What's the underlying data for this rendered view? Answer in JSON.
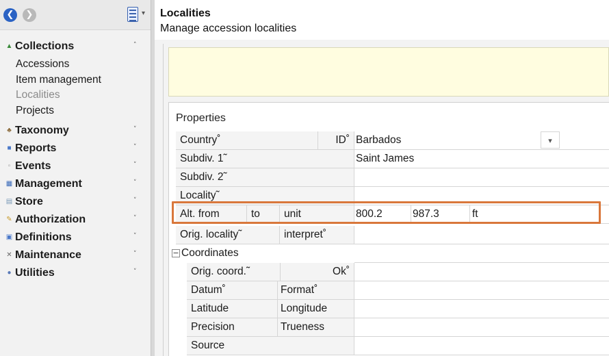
{
  "toolbar": {
    "back_glyph": "❮",
    "forward_glyph": "❯",
    "dropdown_glyph": "▾"
  },
  "sidebar": {
    "sections": [
      {
        "label": "Collections",
        "icon": "collections-icon",
        "icon_color": "#3a8a3a",
        "toggle": "˄",
        "expanded": true,
        "items": [
          "Accessions",
          "Item management",
          "Localities",
          "Projects"
        ],
        "selected": "Localities"
      },
      {
        "label": "Taxonomy",
        "icon": "taxonomy-icon",
        "icon_color": "#8a6a3a",
        "toggle": "˅"
      },
      {
        "label": "Reports",
        "icon": "reports-icon",
        "icon_color": "#4b79c9",
        "toggle": "˅"
      },
      {
        "label": "Events",
        "icon": "events-icon",
        "icon_color": "#9a9a9a",
        "toggle": "˅"
      },
      {
        "label": "Management",
        "icon": "management-icon",
        "icon_color": "#3a6ab9",
        "toggle": "˅"
      },
      {
        "label": "Store",
        "icon": "store-icon",
        "icon_color": "#7a9ab8",
        "toggle": "˅"
      },
      {
        "label": "Authorization",
        "icon": "authorization-icon",
        "icon_color": "#c79a2a",
        "toggle": "˅"
      },
      {
        "label": "Definitions",
        "icon": "definitions-icon",
        "icon_color": "#4b79c9",
        "toggle": "˅"
      },
      {
        "label": "Maintenance",
        "icon": "maintenance-icon",
        "icon_color": "#666666",
        "toggle": "˅"
      },
      {
        "label": "Utilities",
        "icon": "utilities-icon",
        "icon_color": "#5a7ab8",
        "toggle": "˅"
      }
    ]
  },
  "header": {
    "title": "Localities",
    "subtitle": "Manage accession localities"
  },
  "properties": {
    "header": "Properties",
    "country_label": "Country˚",
    "id_label": "ID˚",
    "country_value": "Barbados",
    "subdiv1_label": "Subdiv. 1˜",
    "subdiv1_value": "Saint James",
    "subdiv2_label": "Subdiv. 2˜",
    "locality_label": "Locality˜",
    "alt_from_label": "Alt. from",
    "alt_to_label": "to",
    "alt_unit_label": "unit",
    "alt_from_value": "800.2",
    "alt_to_value": "987.3",
    "alt_unit_value": "ft",
    "orig_locality_label": "Orig. locality˜",
    "interpret_label": "interpret˚",
    "coordinates_toggle": "−",
    "coordinates_label": "Coordinates",
    "orig_coord_label": "Orig. coord.˜",
    "ok_label": "Ok˚",
    "datum_label": "Datum˚",
    "format_label": "Format˚",
    "latitude_label": "Latitude",
    "longitude_label": "Longitude",
    "precision_label": "Precision",
    "trueness_label": "Trueness",
    "source_label": "Source"
  },
  "colors": {
    "highlight": "#d9773b",
    "note_background": "#fffde0",
    "nav_back": "#2b63c4"
  }
}
